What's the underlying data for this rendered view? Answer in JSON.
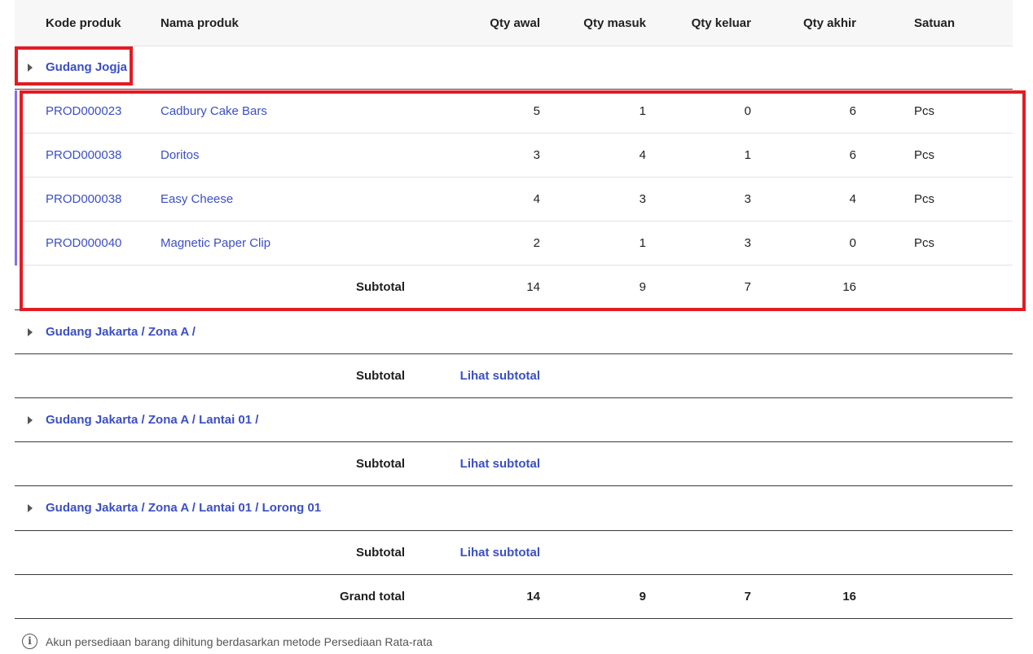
{
  "columns": {
    "code": "Kode produk",
    "name": "Nama produk",
    "qty_start": "Qty awal",
    "qty_in": "Qty masuk",
    "qty_out": "Qty keluar",
    "qty_end": "Qty akhir",
    "unit": "Satuan"
  },
  "groups": [
    {
      "title": "Gudang Jogja",
      "expanded": true,
      "rows": [
        {
          "code": "PROD000023",
          "name": "Cadbury Cake Bars",
          "qty_start": "5",
          "qty_in": "1",
          "qty_out": "0",
          "qty_end": "6",
          "unit": "Pcs"
        },
        {
          "code": "PROD000038",
          "name": "Doritos",
          "qty_start": "3",
          "qty_in": "4",
          "qty_out": "1",
          "qty_end": "6",
          "unit": "Pcs"
        },
        {
          "code": "PROD000038",
          "name": "Easy Cheese",
          "qty_start": "4",
          "qty_in": "3",
          "qty_out": "3",
          "qty_end": "4",
          "unit": "Pcs"
        },
        {
          "code": "PROD000040",
          "name": "Magnetic Paper Clip",
          "qty_start": "2",
          "qty_in": "1",
          "qty_out": "3",
          "qty_end": "0",
          "unit": "Pcs"
        }
      ],
      "subtotal": {
        "label": "Subtotal",
        "qty_start": "14",
        "qty_in": "9",
        "qty_out": "7",
        "qty_end": "16"
      }
    },
    {
      "title": "Gudang Jakarta / Zona A /",
      "expanded": false,
      "subtotal": {
        "label": "Subtotal",
        "link": "Lihat subtotal"
      }
    },
    {
      "title": "Gudang Jakarta / Zona A / Lantai 01 /",
      "expanded": false,
      "subtotal": {
        "label": "Subtotal",
        "link": "Lihat subtotal"
      }
    },
    {
      "title": "Gudang Jakarta / Zona A / Lantai 01 / Lorong 01",
      "expanded": false,
      "subtotal": {
        "label": "Subtotal",
        "link": "Lihat subtotal"
      }
    }
  ],
  "grand_total": {
    "label": "Grand total",
    "qty_start": "14",
    "qty_in": "9",
    "qty_out": "7",
    "qty_end": "16"
  },
  "footnote": "Akun persediaan barang dihitung berdasarkan metode Persediaan Rata-rata",
  "info_icon": "info-icon",
  "highlight_color": "#e31b23"
}
